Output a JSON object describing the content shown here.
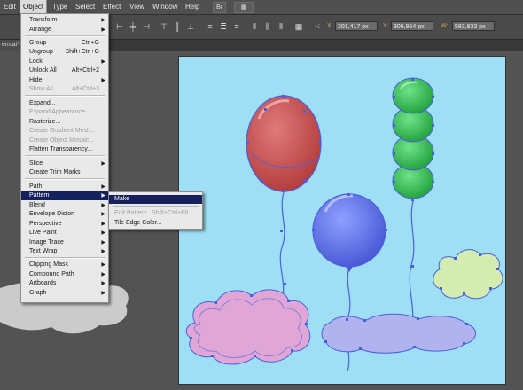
{
  "menubar": {
    "items": [
      "Edit",
      "Object",
      "Type",
      "Select",
      "Effect",
      "View",
      "Window",
      "Help"
    ],
    "active": "Object",
    "btn_bridge": "Br",
    "btn_arrange": "▦"
  },
  "control_bar": {
    "x_label": "X:",
    "x_value": "301,417 px",
    "y_label": "Y:",
    "y_value": "306,954 px",
    "w_label": "W:",
    "w_value": "583,833 px"
  },
  "document_tab": {
    "label": "em.ai*"
  },
  "object_menu": {
    "items": [
      {
        "label": "Transform",
        "shortcut": "",
        "submenu": true,
        "disabled": false
      },
      {
        "label": "Arrange",
        "shortcut": "",
        "submenu": true,
        "disabled": false
      },
      {
        "label": "Group",
        "shortcut": "Ctrl+G",
        "submenu": false,
        "disabled": false
      },
      {
        "label": "Ungroup",
        "shortcut": "Shift+Ctrl+G",
        "submenu": false,
        "disabled": false
      },
      {
        "label": "Lock",
        "shortcut": "",
        "submenu": true,
        "disabled": false
      },
      {
        "label": "Unlock All",
        "shortcut": "Alt+Ctrl+2",
        "submenu": false,
        "disabled": false
      },
      {
        "label": "Hide",
        "shortcut": "",
        "submenu": true,
        "disabled": false
      },
      {
        "label": "Show All",
        "shortcut": "Alt+Ctrl+3",
        "submenu": false,
        "disabled": true
      },
      {
        "label": "Expand...",
        "shortcut": "",
        "submenu": false,
        "disabled": false
      },
      {
        "label": "Expand Appearance",
        "shortcut": "",
        "submenu": false,
        "disabled": true
      },
      {
        "label": "Rasterize...",
        "shortcut": "",
        "submenu": false,
        "disabled": false
      },
      {
        "label": "Create Gradient Mesh...",
        "shortcut": "",
        "submenu": false,
        "disabled": true
      },
      {
        "label": "Create Object Mosaic...",
        "shortcut": "",
        "submenu": false,
        "disabled": true
      },
      {
        "label": "Flatten Transparency...",
        "shortcut": "",
        "submenu": false,
        "disabled": false
      },
      {
        "label": "Slice",
        "shortcut": "",
        "submenu": true,
        "disabled": false
      },
      {
        "label": "Create Trim Marks",
        "shortcut": "",
        "submenu": false,
        "disabled": false
      },
      {
        "label": "Path",
        "shortcut": "",
        "submenu": true,
        "disabled": false
      },
      {
        "label": "Pattern",
        "shortcut": "",
        "submenu": true,
        "disabled": false
      },
      {
        "label": "Blend",
        "shortcut": "",
        "submenu": true,
        "disabled": false
      },
      {
        "label": "Envelope Distort",
        "shortcut": "",
        "submenu": true,
        "disabled": false
      },
      {
        "label": "Perspective",
        "shortcut": "",
        "submenu": true,
        "disabled": false
      },
      {
        "label": "Live Paint",
        "shortcut": "",
        "submenu": true,
        "disabled": false
      },
      {
        "label": "Image Trace",
        "shortcut": "",
        "submenu": true,
        "disabled": false
      },
      {
        "label": "Text Wrap",
        "shortcut": "",
        "submenu": true,
        "disabled": false
      },
      {
        "label": "Clipping Mask",
        "shortcut": "",
        "submenu": true,
        "disabled": false
      },
      {
        "label": "Compound Path",
        "shortcut": "",
        "submenu": true,
        "disabled": false
      },
      {
        "label": "Artboards",
        "shortcut": "",
        "submenu": true,
        "disabled": false
      },
      {
        "label": "Graph",
        "shortcut": "",
        "submenu": true,
        "disabled": false
      }
    ],
    "highlighted": "Pattern"
  },
  "pattern_submenu": {
    "items": [
      {
        "label": "Make",
        "shortcut": "",
        "disabled": false
      },
      {
        "label": "Edit Pattern",
        "shortcut": "Shift+Ctrl+F8",
        "disabled": true
      },
      {
        "label": "Tile Edge Color...",
        "shortcut": "",
        "disabled": false
      }
    ],
    "highlighted": "Make"
  },
  "colors": {
    "artboard": "#9fdff5",
    "menu_highlight": "#15215c",
    "red_balloon": "#c94a4a",
    "green_balloon": "#33c150",
    "blue_balloon": "#5b6ee8",
    "pink_cloud": "#dfa6d6",
    "lilac_cloud": "#b1b3ee",
    "lime_cloud": "#d5ecb0",
    "selection": "#4a5fe0"
  }
}
